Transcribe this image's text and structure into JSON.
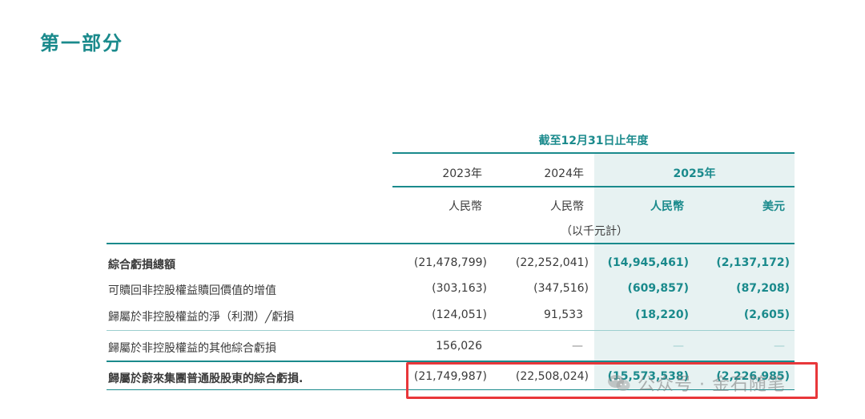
{
  "section_title": "第一部分",
  "table": {
    "period_header": "截至12月31日止年度",
    "years": [
      "2023年",
      "2024年",
      "2025年"
    ],
    "currencies": [
      "人民幣",
      "人民幣",
      "人民幣",
      "美元"
    ],
    "unit_note": "（以千元計）",
    "rows": [
      {
        "label": "綜合虧損總額",
        "v2023": "(21,478,799)",
        "v2024": "(22,252,041)",
        "v2025_rmb": "(14,945,461)",
        "v2025_usd": "(2,137,172)"
      },
      {
        "label": "可贖回非控股權益贖回價值的增值",
        "v2023": "(303,163)",
        "v2024": "(347,516)",
        "v2025_rmb": "(609,857)",
        "v2025_usd": "(87,208)"
      },
      {
        "label": "歸屬於非控股權益的淨（利潤）╱虧損",
        "v2023": "(124,051)",
        "v2024": "91,533",
        "v2025_rmb": "(18,220)",
        "v2025_usd": "(2,605)"
      },
      {
        "label": "歸屬於非控股權益的其他綜合虧損",
        "v2023": "156,026",
        "v2024": "—",
        "v2025_rmb": "—",
        "v2025_usd": "—"
      },
      {
        "label": "歸屬於蔚來集團普通股股東的綜合虧損.",
        "v2023": "(21,749,987)",
        "v2024": "(22,508,024)",
        "v2025_rmb": "(15,573,538)",
        "v2025_usd": "(2,226,985)"
      }
    ]
  },
  "watermark": {
    "text": "公众号 · 金石随笔",
    "icon": "wechat-icon"
  },
  "colors": {
    "accent": "#1a8a8c",
    "highlight": "#e8373a",
    "shade": "#e7f2f2"
  }
}
